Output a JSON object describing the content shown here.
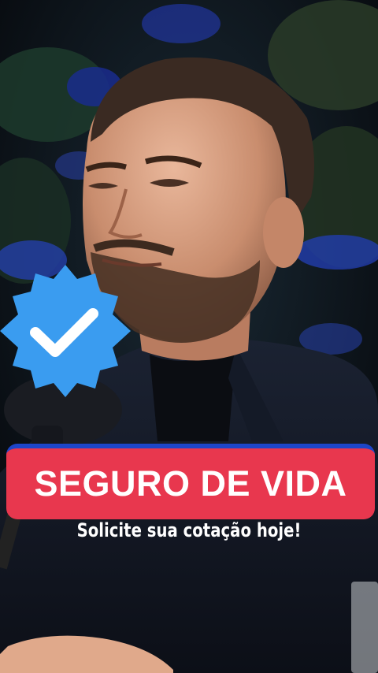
{
  "overlay": {
    "headline": "SEGURO DE VIDA",
    "subline": "Solicite sua cotação hoje!"
  },
  "badge": {
    "icon": "verified-check-icon",
    "color": "#3a9cf0"
  },
  "colors": {
    "headline_bg": "#e8374e",
    "headline_border": "#1d46c9",
    "text": "#ffffff"
  }
}
